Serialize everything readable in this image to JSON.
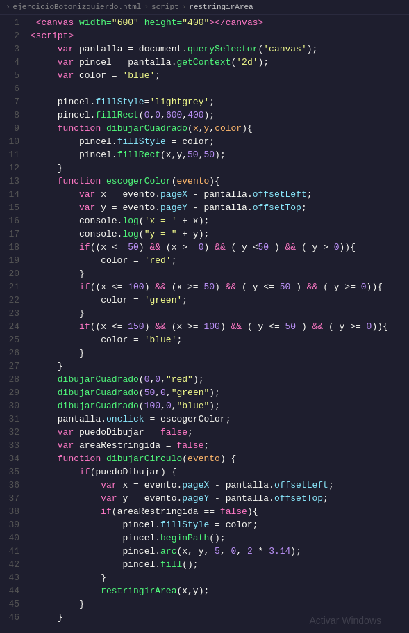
{
  "breadcrumb": {
    "file": "ejercicioBotonizquierdo.html",
    "section1": "script",
    "section2": "restringirArea"
  },
  "watermark": "Activar Windows"
}
